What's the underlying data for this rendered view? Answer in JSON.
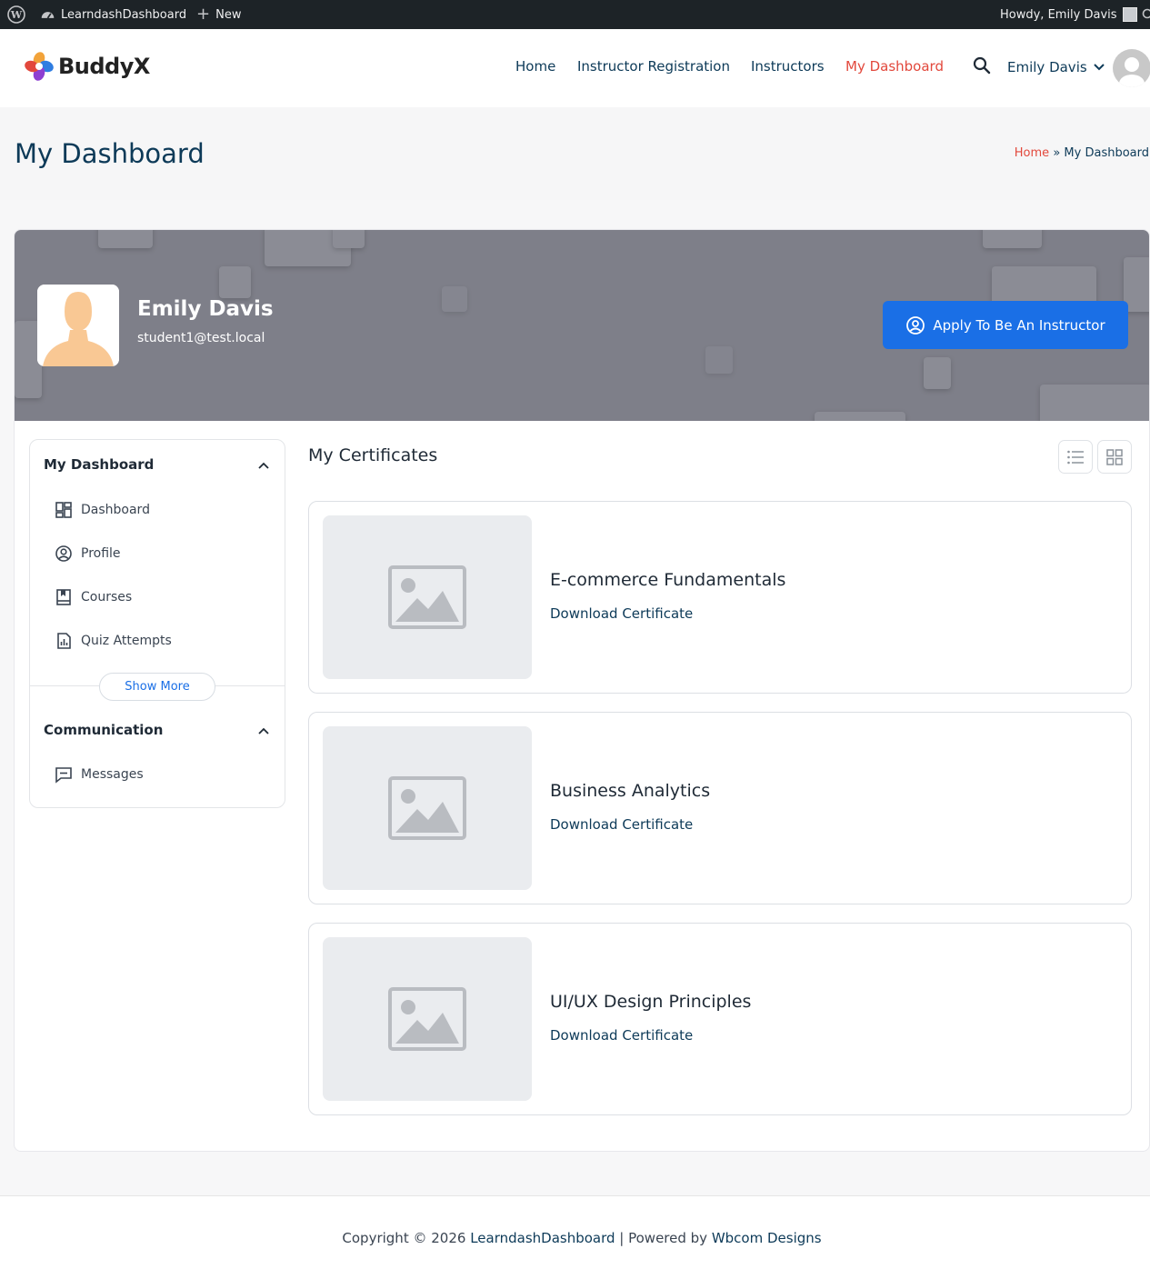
{
  "admin_bar": {
    "site_name": "LearndashDashboard",
    "new_label": "New",
    "greeting": "Howdy, Emily Davis"
  },
  "header": {
    "logo_text": "BuddyX",
    "nav": [
      {
        "label": "Home",
        "active": false
      },
      {
        "label": "Instructor Registration",
        "active": false
      },
      {
        "label": "Instructors",
        "active": false
      },
      {
        "label": "My Dashboard",
        "active": true
      }
    ],
    "user_name": "Emily Davis"
  },
  "page": {
    "title": "My Dashboard",
    "breadcrumb_home": "Home",
    "breadcrumb_sep": "»",
    "breadcrumb_current": "My Dashboard"
  },
  "profile": {
    "name": "Emily Davis",
    "email": "student1@test.local",
    "apply_button": "Apply To Be An Instructor"
  },
  "sidebar": {
    "sections": [
      {
        "title": "My Dashboard",
        "items": [
          {
            "label": "Dashboard",
            "icon": "dashboard-grid-icon"
          },
          {
            "label": "Profile",
            "icon": "user-circle-icon"
          },
          {
            "label": "Courses",
            "icon": "book-icon"
          },
          {
            "label": "Quiz Attempts",
            "icon": "chart-document-icon"
          }
        ],
        "show_more": "Show More"
      },
      {
        "title": "Communication",
        "items": [
          {
            "label": "Messages",
            "icon": "message-icon"
          }
        ]
      }
    ]
  },
  "content": {
    "title": "My Certificates",
    "certificates": [
      {
        "title": "E-commerce Fundamentals",
        "link": "Download Certificate"
      },
      {
        "title": "Business Analytics",
        "link": "Download Certificate"
      },
      {
        "title": "UI/UX Design Principles",
        "link": "Download Certificate"
      }
    ]
  },
  "footer": {
    "prefix": "Copyright © 2026 ",
    "site_link": "LearndashDashboard",
    "middle": " | Powered by ",
    "powered_link": "Wbcom Designs"
  },
  "colors": {
    "accent": "#e2483c",
    "primary_text": "#0d3a58",
    "button_blue": "#1a6fe6",
    "banner_gray": "#7e7f89"
  }
}
